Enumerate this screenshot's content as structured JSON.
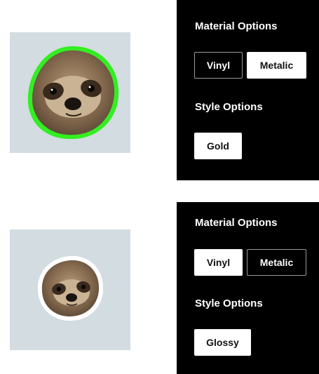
{
  "configurators": [
    {
      "preview": {
        "description_icon": "sloth-sticker-icon",
        "border_color": "#33ee22",
        "finish": "Metalic Gold"
      },
      "material": {
        "title": "Material Options",
        "options": [
          {
            "label": "Vinyl",
            "selected": false
          },
          {
            "label": "Metalic",
            "selected": true
          }
        ]
      },
      "style": {
        "title": "Style Options",
        "options": [
          {
            "label": "Gold",
            "selected": true
          }
        ]
      }
    },
    {
      "preview": {
        "description_icon": "sloth-sticker-icon",
        "border_color": "#ffffff",
        "finish": "Vinyl Glossy"
      },
      "material": {
        "title": "Material Options",
        "options": [
          {
            "label": "Vinyl",
            "selected": true
          },
          {
            "label": "Metalic",
            "selected": false
          }
        ]
      },
      "style": {
        "title": "Style Options",
        "options": [
          {
            "label": "Glossy",
            "selected": true
          }
        ]
      }
    }
  ],
  "colors": {
    "panel_background": "#000000",
    "preview_background": "#d3dce1",
    "selected_button": "#ffffff",
    "unselected_border": "#9a9a9a"
  }
}
